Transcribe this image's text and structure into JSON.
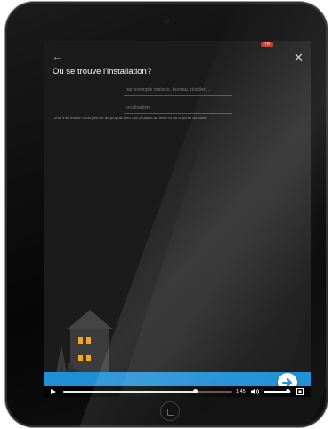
{
  "status_bar": {
    "badge_text": "18",
    "badge_color": "#c0392b"
  },
  "header": {
    "back_icon": "arrow-left-icon",
    "close_icon": "close-icon",
    "title": "Où se trouve l'installation?"
  },
  "form": {
    "name_field": {
      "value": "",
      "placeholder": "par exemple maison, bureau, résiden..."
    },
    "location_field": {
      "value": "",
      "placeholder": "localisation"
    },
    "help_text": "Cette information vous permet de programmer des produits au lever et au coucher du soleil."
  },
  "illustration": {
    "icon": "house-icon",
    "window_color": "#f5a623"
  },
  "footer": {
    "accent_color": "#1f8fd6",
    "next_icon": "arrow-right-icon"
  },
  "video_controls": {
    "time": "1:45",
    "progress_percent": 78,
    "volume_percent": 85,
    "play_icon": "play-icon",
    "volume_icon": "volume-icon",
    "fullscreen_icon": "fullscreen-icon"
  }
}
